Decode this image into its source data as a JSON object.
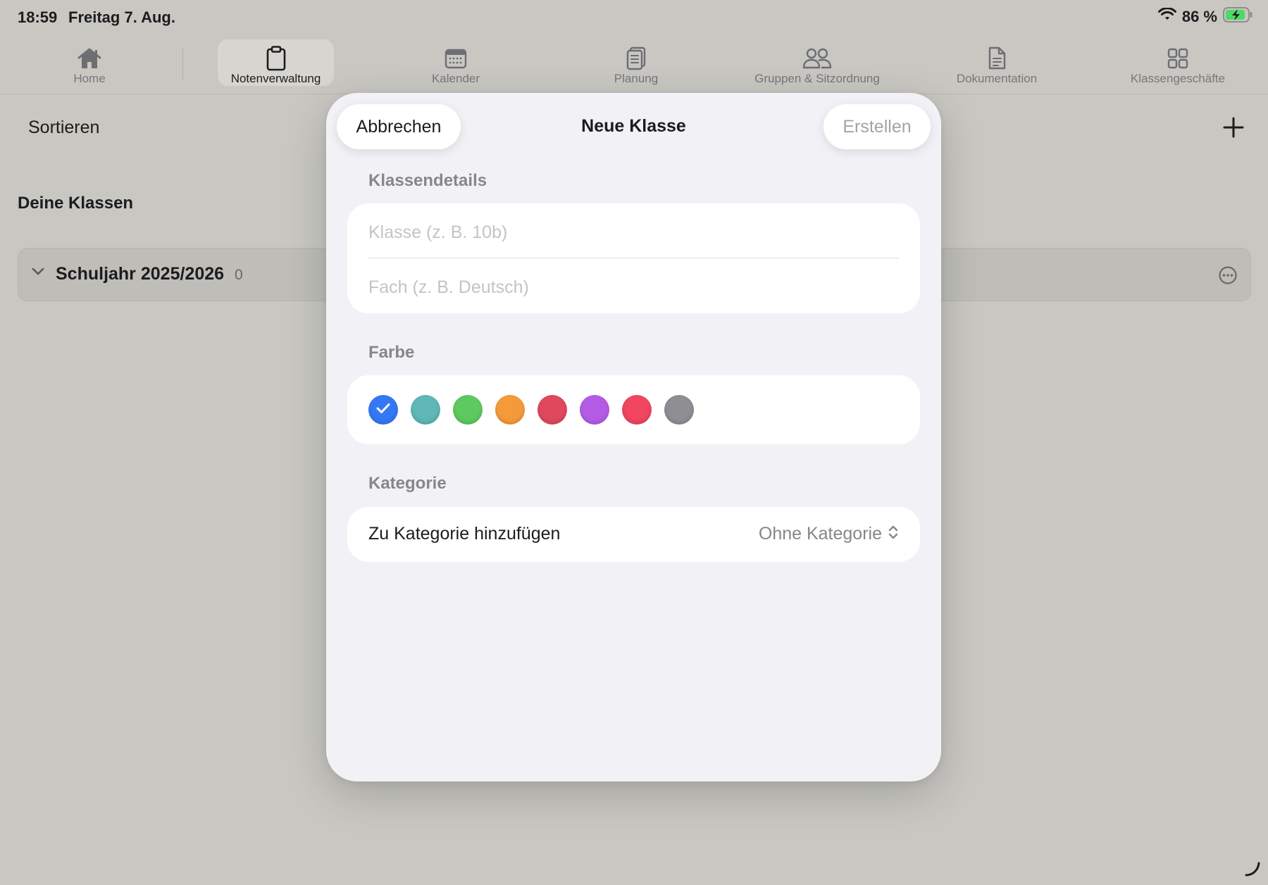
{
  "status_bar": {
    "time": "18:59",
    "date": "Freitag 7. Aug.",
    "battery": "86 %"
  },
  "tabs": [
    {
      "label": "Home",
      "icon": "house-icon",
      "active": false
    },
    {
      "label": "Notenverwaltung",
      "icon": "clipboard-icon",
      "active": true
    },
    {
      "label": "Kalender",
      "icon": "calendar-icon",
      "active": false
    },
    {
      "label": "Planung",
      "icon": "document-stack-icon",
      "active": false
    },
    {
      "label": "Gruppen & Sitzordnung",
      "icon": "people-icon",
      "active": false
    },
    {
      "label": "Dokumentation",
      "icon": "document-icon",
      "active": false
    },
    {
      "label": "Klassengeschäfte",
      "icon": "grid-icon",
      "active": false
    }
  ],
  "background": {
    "sort_label": "Sortieren",
    "section_heading": "Deine Klassen",
    "year_title": "Schuljahr 2025/2026",
    "year_count": "0"
  },
  "modal": {
    "cancel_label": "Abbrechen",
    "title": "Neue Klasse",
    "create_label": "Erstellen",
    "details_label": "Klassendetails",
    "class_placeholder": "Klasse (z. B. 10b)",
    "subject_placeholder": "Fach (z. B. Deutsch)",
    "color_label": "Farbe",
    "colors": [
      {
        "name": "blue",
        "hex": "#3478f6",
        "selected": true
      },
      {
        "name": "teal",
        "hex": "#5fb7b7",
        "selected": false
      },
      {
        "name": "green",
        "hex": "#5ec95e",
        "selected": false
      },
      {
        "name": "orange",
        "hex": "#f49a3a",
        "selected": false
      },
      {
        "name": "red",
        "hex": "#e0485e",
        "selected": false
      },
      {
        "name": "purple",
        "hex": "#b45be6",
        "selected": false
      },
      {
        "name": "pink",
        "hex": "#f0465f",
        "selected": false
      },
      {
        "name": "gray",
        "hex": "#8e8e93",
        "selected": false
      }
    ],
    "category_label": "Kategorie",
    "category_row_label": "Zu Kategorie hinzufügen",
    "category_value": "Ohne Kategorie"
  }
}
